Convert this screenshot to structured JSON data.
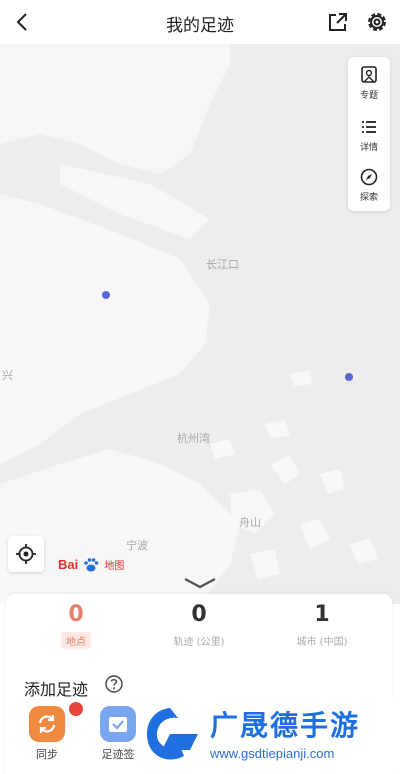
{
  "header": {
    "title": "我的足迹"
  },
  "side_panel": [
    {
      "label": "专题",
      "icon": "topic-icon"
    },
    {
      "label": "详情",
      "icon": "list-icon"
    },
    {
      "label": "探索",
      "icon": "explore-icon"
    }
  ],
  "map": {
    "labels": {
      "changjiangkou": "长江口",
      "hangzhouwan": "杭州湾",
      "zhoushan": "舟山",
      "ningbo": "宁波",
      "edge": "兴"
    },
    "logo": {
      "bai": "Bai",
      "du": "地图"
    },
    "marker_color": "#5b67d6"
  },
  "stats": [
    {
      "value": "0",
      "label": "地点"
    },
    {
      "value": "0",
      "label": "轨迹 (公里)"
    },
    {
      "value": "1",
      "label": "城市 (中国)"
    }
  ],
  "add": {
    "title": "添加足迹",
    "actions": [
      {
        "label": "同步"
      },
      {
        "label": "足迹签"
      }
    ]
  },
  "watermark": {
    "brand": "广晟德手游",
    "url": "www.gsdtiepianji.com"
  },
  "colors": {
    "accent": "#e5806d",
    "brand_blue": "#1f6fe0"
  }
}
